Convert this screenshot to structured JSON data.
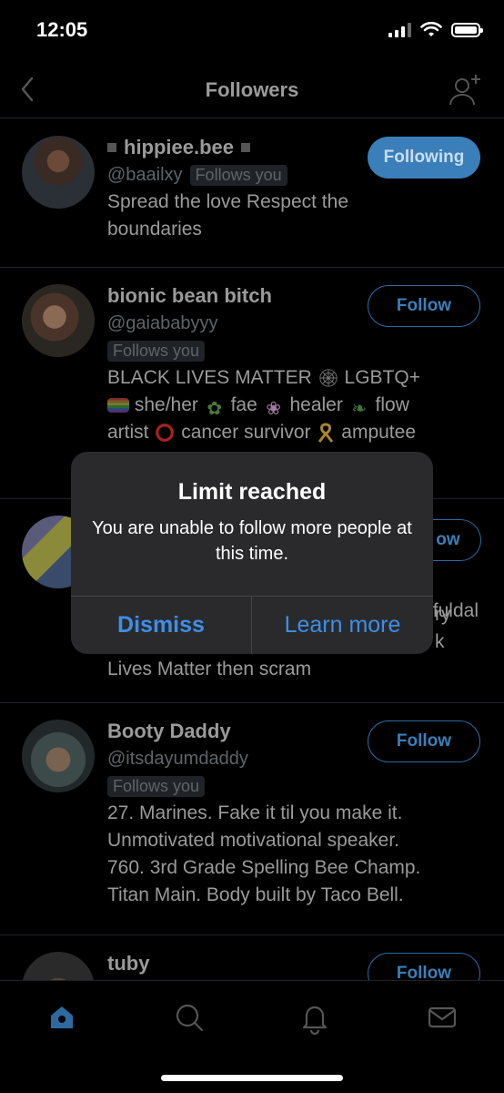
{
  "status": {
    "time": "12:05"
  },
  "nav": {
    "title": "Followers"
  },
  "followers": [
    {
      "name": "hippiee.bee",
      "handle": "@baailxy",
      "badge": "Follows you",
      "bio": [
        "Spread the love Respect the",
        "boundaries"
      ],
      "button": "Following"
    },
    {
      "name": "bionic bean bitch",
      "handle": "@gaiababyyy",
      "badge": "Follows you",
      "bio": [
        "BLACK LIVES MATTER",
        "LGBTQ+",
        "she/her",
        "fae",
        "healer",
        "flow",
        "artist",
        "cancer survivor",
        "amputee"
      ],
      "bio_right_fragment": "fuldal",
      "button": "Follow"
    },
    {
      "bio_fragments": [
        "ry",
        "k",
        "Lives Matter then scram"
      ],
      "button_fragment": "ow"
    },
    {
      "name": "Booty Daddy",
      "handle": "@itsdayumdaddy",
      "badge": "Follows you",
      "bio": [
        "27. Marines. Fake it til you make it.",
        "Unmotivated motivational speaker.",
        "760. 3rd Grade Spelling Bee Champ.",
        "Titan Main. Body built by Taco Bell."
      ],
      "button": "Follow"
    },
    {
      "name": "tuby",
      "button": "Follow"
    }
  ],
  "dialog": {
    "title": "Limit reached",
    "message": "You are unable to follow more people at this time.",
    "dismiss": "Dismiss",
    "learn_more": "Learn more"
  },
  "tabs": [
    "home-icon",
    "search-icon",
    "bell-icon",
    "mail-icon"
  ],
  "colors": {
    "accent": "#1d9bf0",
    "dialog_button": "#3d8fe8",
    "dialog_bg": "#2a2a2c"
  }
}
